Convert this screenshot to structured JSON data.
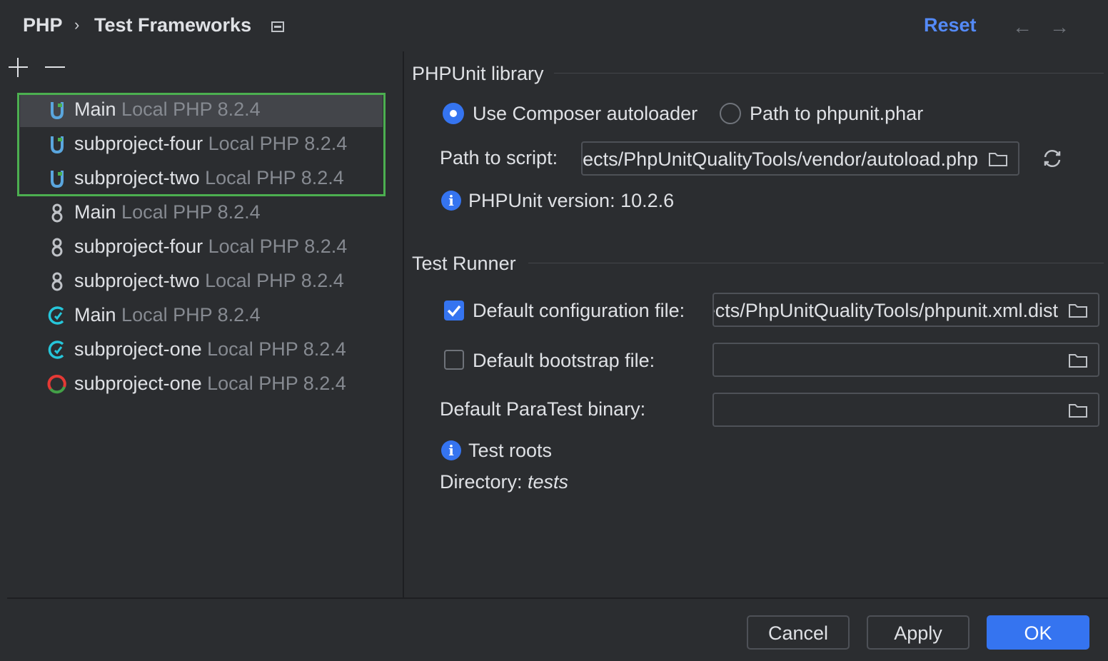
{
  "header": {
    "breadcrumb": [
      "PHP",
      "Test Frameworks"
    ],
    "separator": "›",
    "reset_label": "Reset",
    "back_arrow": "←",
    "forward_arrow": "→"
  },
  "frameworks_list": [
    {
      "name": "Main",
      "interpreter": "Local PHP 8.2.4",
      "icon": "phpunit-icon",
      "selected": true
    },
    {
      "name": "subproject-four",
      "interpreter": "Local PHP 8.2.4",
      "icon": "phpunit-icon",
      "selected": false
    },
    {
      "name": "subproject-two",
      "interpreter": "Local PHP 8.2.4",
      "icon": "phpunit-icon",
      "selected": false
    },
    {
      "name": "Main",
      "interpreter": "Local PHP 8.2.4",
      "icon": "behat-icon",
      "selected": false
    },
    {
      "name": "subproject-four",
      "interpreter": "Local PHP 8.2.4",
      "icon": "behat-icon",
      "selected": false
    },
    {
      "name": "subproject-two",
      "interpreter": "Local PHP 8.2.4",
      "icon": "behat-icon",
      "selected": false
    },
    {
      "name": "Main",
      "interpreter": "Local PHP 8.2.4",
      "icon": "codeception-icon",
      "selected": false
    },
    {
      "name": "subproject-one",
      "interpreter": "Local PHP 8.2.4",
      "icon": "codeception-icon",
      "selected": false
    },
    {
      "name": "subproject-one",
      "interpreter": "Local PHP 8.2.4",
      "icon": "pest-icon",
      "selected": false
    }
  ],
  "phpunit_library": {
    "title": "PHPUnit library",
    "option_composer": "Use Composer autoloader",
    "option_phar": "Path to phpunit.phar",
    "path_label": "Path to script:",
    "path_value": "…/Projects/PhpUnitQualityTools/vendor/autoload.php",
    "version_text": "PHPUnit version: 10.2.6"
  },
  "test_runner": {
    "title": "Test Runner",
    "default_config_label": "Default configuration file:",
    "default_config_value": "…/Projects/PhpUnitQualityTools/phpunit.xml.dist",
    "default_bootstrap_label": "Default bootstrap file:",
    "default_bootstrap_value": "",
    "paratest_label": "Default ParaTest binary:",
    "paratest_value": "",
    "test_roots_label": "Test roots",
    "directory_label": "Directory:",
    "directory_value": "tests"
  },
  "footer": {
    "cancel_label": "Cancel",
    "apply_label": "Apply",
    "ok_label": "OK"
  },
  "colors": {
    "accent": "#3574f0",
    "link": "#548af7",
    "highlight_border": "#4caf50",
    "background": "#2b2d30"
  }
}
